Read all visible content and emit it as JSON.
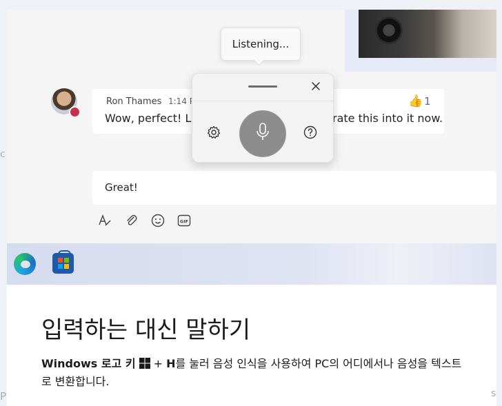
{
  "chat": {
    "message": {
      "author": "Ron Thames",
      "time": "1:14 P",
      "text_visible_left": "Wow, perfect! Le",
      "text_visible_right": "rate this into it now.",
      "reaction_count": "1"
    },
    "compose": {
      "text": "Great!"
    },
    "toolbar": [
      "format-icon",
      "attach-icon",
      "emoji-icon",
      "gif-icon"
    ]
  },
  "voice_panel": {
    "tooltip": "Listening..."
  },
  "taskbar": {
    "icons": [
      "edge-icon",
      "store-icon"
    ]
  },
  "doc": {
    "heading": "입력하는 대신 말하기",
    "para_bold_1": "Windows 로고 키",
    "para_plus": "+",
    "para_bold_2": "H",
    "para_rest": "를 눌러 음성 인식을 사용하여 PC의 어디에서나 음성을 텍스트로 변환합니다."
  },
  "edges": {
    "left_fragment_1": "c",
    "left_fragment_2": "P",
    "right_fragment": "s"
  },
  "colors": {
    "accent": "#5b5fc7",
    "presence_busy": "#c4314b",
    "mic_button": "#8c8c8c"
  }
}
